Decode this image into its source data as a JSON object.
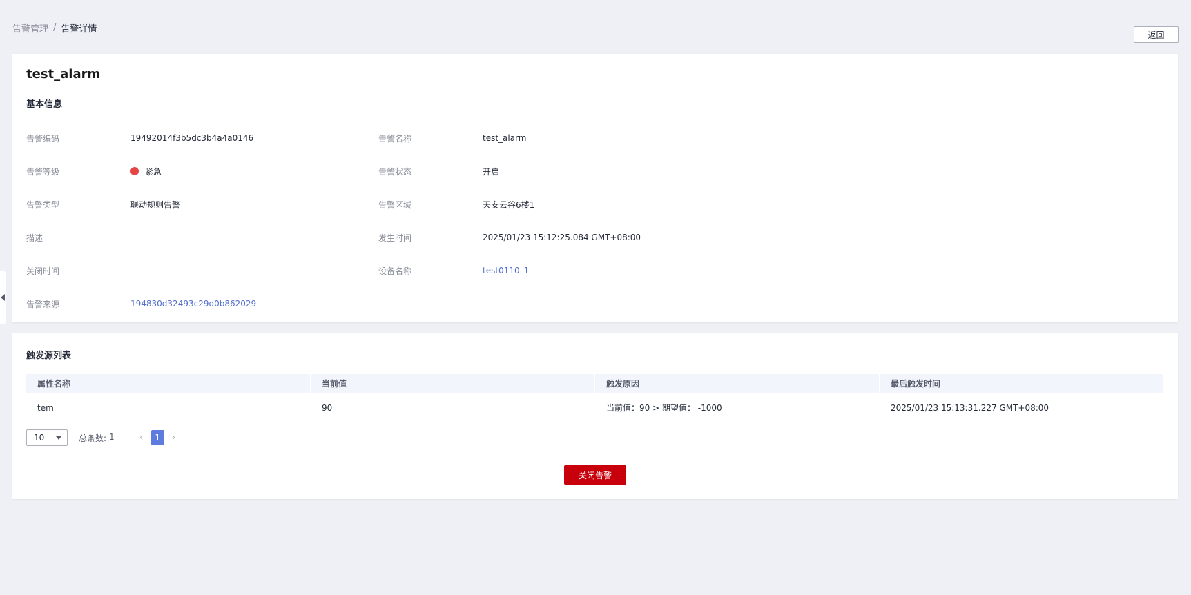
{
  "breadcrumb": {
    "parent": "告警管理",
    "separator": "/",
    "current": "告警详情"
  },
  "header": {
    "back_label": "返回"
  },
  "alarm": {
    "title": "test_alarm",
    "basic_section_title": "基本信息",
    "fields": {
      "code_label": "告警编码",
      "code_value": "19492014f3b5dc3b4a4a0146",
      "name_label": "告警名称",
      "name_value": "test_alarm",
      "level_label": "告警等级",
      "level_value": "紧急",
      "level_color": "#e54545",
      "status_label": "告警状态",
      "status_value": "开启",
      "type_label": "告警类型",
      "type_value": "联动规则告警",
      "area_label": "告警区域",
      "area_value": "天安云谷6楼1",
      "desc_label": "描述",
      "desc_value": "",
      "occur_label": "发生时间",
      "occur_value": "2025/01/23 15:12:25.084 GMT+08:00",
      "close_label": "关闭时间",
      "close_value": "",
      "device_label": "设备名称",
      "device_value": "test0110_1",
      "source_label": "告警来源",
      "source_value": "194830d32493c29d0b862029"
    }
  },
  "trigger": {
    "section_title": "触发源列表",
    "columns": [
      "属性名称",
      "当前值",
      "触发原因",
      "最后触发时间"
    ],
    "rows": [
      [
        "tem",
        "90",
        "当前值：90 > 期望值： -1000",
        "2025/01/23 15:13:31.227 GMT+08:00"
      ]
    ],
    "pager": {
      "page_size": "10",
      "total_label": "总条数:",
      "total_count": "1",
      "prev_icon": "‹",
      "next_icon": "›",
      "current_page": "1"
    },
    "close_button_label": "关闭告警"
  },
  "colors": {
    "accent": "#5e7ce0",
    "danger_button": "#c7000b",
    "link": "#526ecc"
  }
}
